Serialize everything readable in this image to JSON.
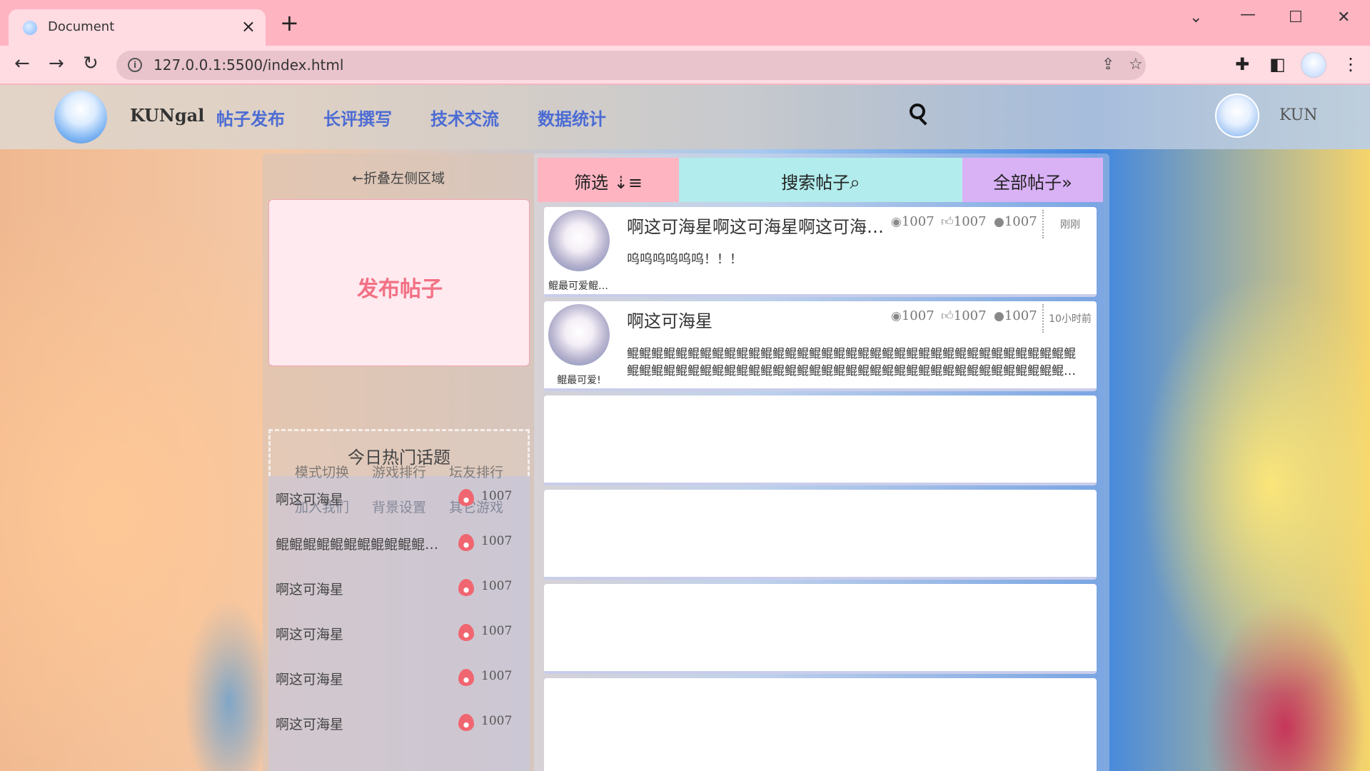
{
  "browser": {
    "tab_title": "Document",
    "url": "127.0.0.1:5500/index.html"
  },
  "navbar": {
    "brand": "KUNgal",
    "links": [
      "帖子发布",
      "长评撰写",
      "技术交流",
      "数据统计"
    ],
    "user_name": "KUN"
  },
  "left_panel": {
    "collapse_label": "←折叠左侧区域",
    "publish_label": "发布帖子",
    "quick_links": [
      "模式切换",
      "游戏排行",
      "坛友排行",
      "加入我们",
      "背景设置",
      "其它游戏"
    ],
    "hot_topics_title": "今日热门话题",
    "hot_topics": [
      {
        "title": "啊这可海星",
        "count": "1007"
      },
      {
        "title": "鲲鲲鲲鲲鲲鲲鲲鲲鲲鲲鲲鲲鲲鲲",
        "count": "1007"
      },
      {
        "title": "啊这可海星",
        "count": "1007"
      },
      {
        "title": "啊这可海星",
        "count": "1007"
      },
      {
        "title": "啊这可海星",
        "count": "1007"
      },
      {
        "title": "啊这可海星",
        "count": "1007"
      }
    ]
  },
  "tabs": {
    "filter": "筛选",
    "search": "搜索帖子",
    "all": "全部帖子"
  },
  "posts": [
    {
      "author": "鲲最可爱鲲最可爱",
      "title": "啊这可海星啊这可海星啊这可海星啊这可海星",
      "views": "1007",
      "likes": "1007",
      "comments": "1007",
      "time": "刚刚",
      "body": "呜呜呜呜呜呜！！！"
    },
    {
      "author": "鲲最可爱!",
      "title": "啊这可海星",
      "views": "1007",
      "likes": "1007",
      "comments": "1007",
      "time": "10小时前",
      "body": "鲲鲲鲲鲲鲲鲲鲲鲲鲲鲲鲲鲲鲲鲲鲲鲲鲲鲲鲲鲲鲲鲲鲲鲲鲲鲲鲲鲲鲲鲲鲲鲲鲲鲲鲲鲲鲲鲲鲲鲲鲲鲲鲲鲲鲲鲲鲲鲲鲲鲲鲲鲲鲲鲲鲲鲲鲲鲲鲲鲲鲲鲲鲲鲲鲲鲲鲲鲲鲲鲲鲲鲲鲲鲲鲲鲲鲲鲲鲲鲲"
    }
  ]
}
